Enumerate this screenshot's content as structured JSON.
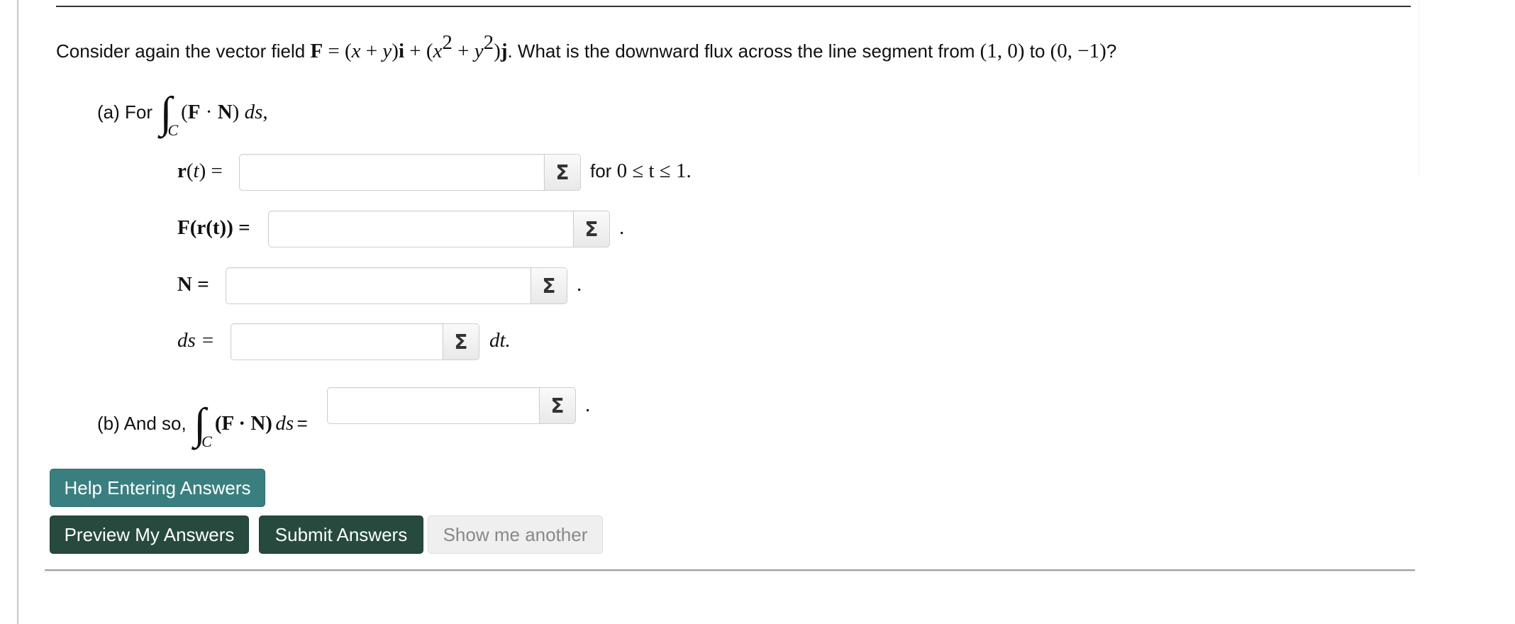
{
  "question": {
    "intro": "Consider again the vector field ",
    "field_symbol": "F",
    "eq": " = (",
    "x": "x",
    "plus1": " + ",
    "y": "y",
    "close_i": ")",
    "i": "i",
    "plus2": " + (",
    "x2": "x",
    "exp1": "2",
    "plus3": " + ",
    "y2": "y",
    "exp2": "2",
    "close_j": ")",
    "j": "j",
    "mid": ". What is the downward flux across the line segment from ",
    "p1": "(1, 0)",
    "to": " to ",
    "p2": "(0, −1)",
    "end": "?"
  },
  "part_a": {
    "label": "(a) For",
    "integral": "∫",
    "sub": "C",
    "expr_open": "(",
    "F": "F",
    "dot": " · ",
    "N": "N",
    "expr_close": ") ",
    "ds": "ds",
    "comma": ","
  },
  "rows": {
    "r": {
      "label_bold": "r",
      "label_rest": "(t) =",
      "t": "t",
      "value": "",
      "suffix_sans": "for ",
      "suffix_math": "0 ≤ t ≤ 1."
    },
    "F": {
      "label": "F(r(t)) =",
      "value": "",
      "suffix": "."
    },
    "N": {
      "label": "N =",
      "value": "",
      "suffix": "."
    },
    "ds": {
      "label": "ds =",
      "value": "",
      "suffix": "dt."
    }
  },
  "part_b": {
    "label": "(b) And so,",
    "integral": "∫",
    "sub": "C",
    "expr": "(F · N)",
    "ds": "ds",
    "eq": "=",
    "value": "",
    "suffix": "."
  },
  "sigma_icon": "Σ",
  "buttons": {
    "help": "Help Entering Answers",
    "preview": "Preview My Answers",
    "submit": "Submit Answers",
    "another": "Show me another"
  },
  "colors": {
    "help_bg": "#3a7f80",
    "primary_bg": "#264a3e",
    "disabled_bg": "#efefef",
    "disabled_text": "#888888"
  }
}
